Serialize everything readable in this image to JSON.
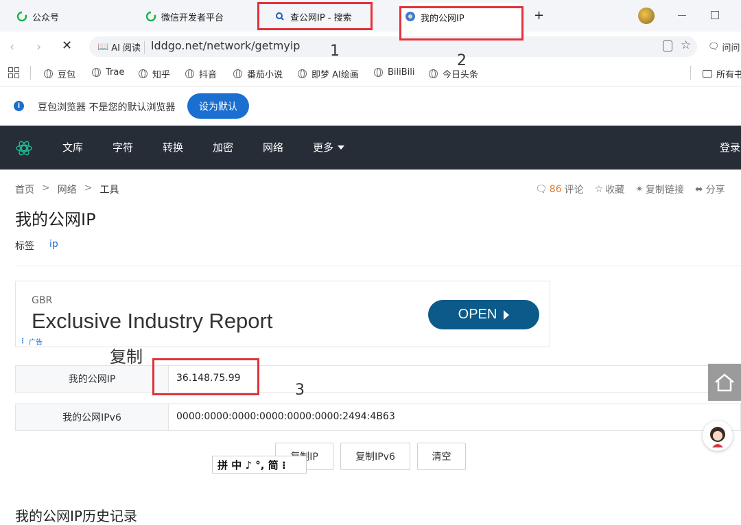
{
  "tabs": [
    {
      "label": "公众号"
    },
    {
      "label": "微信开发者平台"
    },
    {
      "label": "查公网IP - 搜索"
    },
    {
      "label": "我的公网IP"
    }
  ],
  "new_tab": "+",
  "address": {
    "reader": "AI 阅读",
    "url": "lddgo.net/network/getmyip",
    "ask": "问问"
  },
  "bookmarks": [
    "豆包",
    "Trae",
    "知乎",
    "抖音",
    "番茄小说",
    "即梦 AI绘画",
    "BiliBili",
    "今日头条"
  ],
  "all_bookmarks": "所有书",
  "notice": {
    "text": "豆包浏览器 不是您的默认浏览器",
    "button": "设为默认"
  },
  "nav": {
    "items": [
      "文库",
      "字符",
      "转换",
      "加密",
      "网络",
      "更多"
    ],
    "login": "登录"
  },
  "breadcrumb": [
    "首页",
    "网络",
    "工具"
  ],
  "actions": {
    "comment_count": "86",
    "comment": "评论",
    "favorite": "收藏",
    "copy_link": "复制链接",
    "share": "分享"
  },
  "page": {
    "title": "我的公网IP",
    "tags_label": "标签",
    "tag": "ip"
  },
  "ad": {
    "small": "GBR",
    "headline": "Exclusive Industry Report",
    "open": "OPEN",
    "ad_label": "广告"
  },
  "ip": {
    "label_v4": "我的公网IP",
    "value_v4": "36.148.75.99",
    "label_v6": "我的公网IPv6",
    "value_v6": "0000:0000:0000:0000:0000:0000:2494:4B63"
  },
  "buttons": {
    "copy_ip": "复制IP",
    "copy_ipv6": "复制IPv6",
    "clear": "清空"
  },
  "ime": {
    "text": "拼 中 ♪ °, 简 ⁝"
  },
  "history_title": "我的公网IP历史记录",
  "annotations": {
    "n1": "1",
    "n2": "2",
    "n3": "3",
    "copy": "复制"
  },
  "colors": {
    "nav_bg": "#262d37",
    "accent": "#1a6fd0",
    "annotation_red": "#e2313a",
    "ad_blue": "#0c5a8a"
  }
}
